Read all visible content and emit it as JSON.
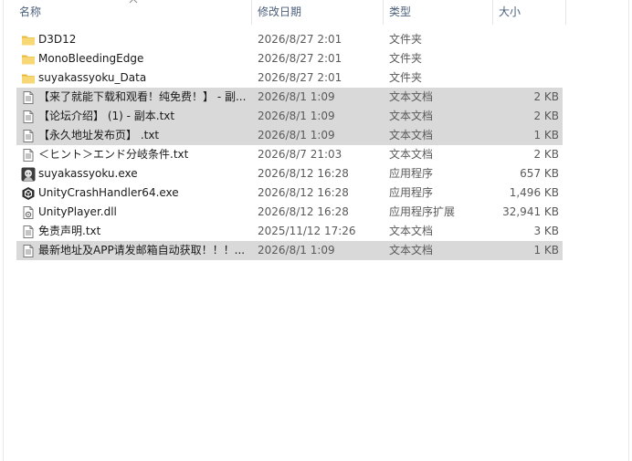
{
  "columns": {
    "name": "名称",
    "date": "修改日期",
    "type": "类型",
    "size": "大小"
  },
  "files": [
    {
      "name": "D3D12",
      "date": "2026/8/27 2:01",
      "type": "文件夹",
      "size": "",
      "icon": "folder-icon",
      "selected": false
    },
    {
      "name": "MonoBleedingEdge",
      "date": "2026/8/27 2:01",
      "type": "文件夹",
      "size": "",
      "icon": "folder-icon",
      "selected": false
    },
    {
      "name": "suyakassyoku_Data",
      "date": "2026/8/27 2:01",
      "type": "文件夹",
      "size": "",
      "icon": "folder-icon",
      "selected": false
    },
    {
      "name": "【来了就能下载和观看！纯免费！】 - 副...",
      "date": "2026/8/1 1:09",
      "type": "文本文档",
      "size": "2 KB",
      "icon": "text-file-icon",
      "selected": true
    },
    {
      "name": "【论坛介绍】 (1) - 副本.txt",
      "date": "2026/8/1 1:09",
      "type": "文本文档",
      "size": "2 KB",
      "icon": "text-file-icon",
      "selected": true
    },
    {
      "name": "【永久地址发布页】 .txt",
      "date": "2026/8/1 1:09",
      "type": "文本文档",
      "size": "1 KB",
      "icon": "text-file-icon",
      "selected": true
    },
    {
      "name": "＜ヒント＞エンド分岐条件.txt",
      "date": "2026/8/7 21:03",
      "type": "文本文档",
      "size": "2 KB",
      "icon": "text-file-icon",
      "selected": false
    },
    {
      "name": "suyakassyoku.exe",
      "date": "2026/8/12 16:28",
      "type": "应用程序",
      "size": "657 KB",
      "icon": "game-app-icon",
      "selected": false
    },
    {
      "name": "UnityCrashHandler64.exe",
      "date": "2026/8/12 16:28",
      "type": "应用程序",
      "size": "1,496 KB",
      "icon": "unity-icon",
      "selected": false
    },
    {
      "name": "UnityPlayer.dll",
      "date": "2026/8/12 16:28",
      "type": "应用程序扩展",
      "size": "32,941 KB",
      "icon": "dll-file-icon",
      "selected": false
    },
    {
      "name": "免责声明.txt",
      "date": "2025/11/12 17:26",
      "type": "文本文档",
      "size": "3 KB",
      "icon": "text-file-icon",
      "selected": false
    },
    {
      "name": "最新地址及APP请发邮箱自动获取！！！...",
      "date": "2026/8/1 1:09",
      "type": "文本文档",
      "size": "1 KB",
      "icon": "text-file-icon",
      "selected": true
    }
  ],
  "colors": {
    "selection": "#d9d9d9",
    "header_text": "#4c607a",
    "folder": "#f8d775"
  }
}
